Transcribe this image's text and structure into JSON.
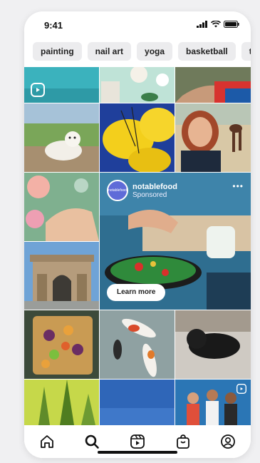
{
  "status_bar": {
    "time": "9:41"
  },
  "chips": [
    "painting",
    "nail art",
    "yoga",
    "basketball",
    "to"
  ],
  "sponsored_post": {
    "account": "notablefood",
    "label": "Sponsored",
    "avatar_text": "notablefood",
    "cta": "Learn more"
  },
  "grid_tiles": [
    {
      "name": "reel-tile-teal",
      "icon": "reels-icon"
    },
    {
      "name": "photo-tile-skincare"
    },
    {
      "name": "photo-tile-arm"
    },
    {
      "name": "photo-tile-white-dog"
    },
    {
      "name": "photo-tile-yellow-balloons"
    },
    {
      "name": "photo-tile-selfie-dog"
    },
    {
      "name": "photo-tile-flowers"
    },
    {
      "name": "photo-tile-arch"
    },
    {
      "name": "photo-tile-salad"
    },
    {
      "name": "photo-tile-koi"
    },
    {
      "name": "photo-tile-black-dog"
    },
    {
      "name": "photo-tile-cactus"
    },
    {
      "name": "photo-tile-sky"
    },
    {
      "name": "reel-tile-group",
      "icon": "reels-icon"
    }
  ],
  "tab_bar": [
    "home-icon",
    "search-icon",
    "reels-icon",
    "shop-icon",
    "profile-icon"
  ]
}
